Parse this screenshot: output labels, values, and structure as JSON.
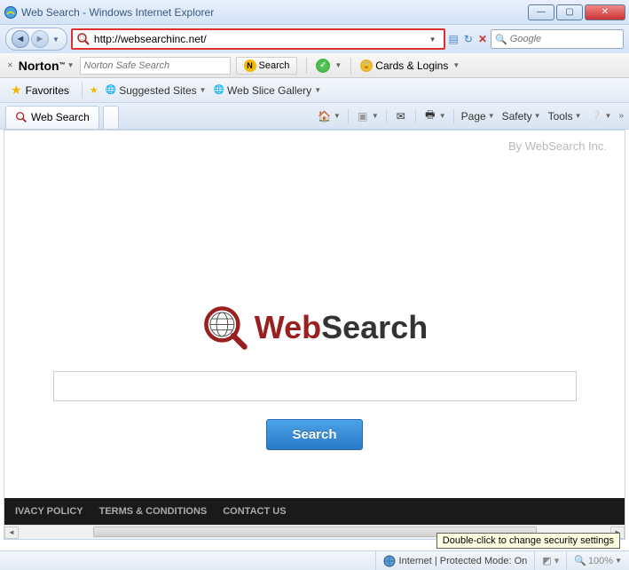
{
  "window": {
    "title": "Web Search - Windows Internet Explorer"
  },
  "address_bar": {
    "url": "http://websearchinc.net/"
  },
  "browser_search": {
    "placeholder": "Google"
  },
  "norton": {
    "brand": "Norton",
    "search_placeholder": "Norton Safe Search",
    "search_button": "Search",
    "cards_logins": "Cards & Logins"
  },
  "favorites_bar": {
    "favorites": "Favorites",
    "suggested_sites": "Suggested Sites",
    "web_slice_gallery": "Web Slice Gallery"
  },
  "tab": {
    "title": "Web Search"
  },
  "command_bar": {
    "page": "Page",
    "safety": "Safety",
    "tools": "Tools"
  },
  "page": {
    "attribution": "By WebSearch Inc.",
    "logo_web": "Web",
    "logo_search": "Search",
    "search_button": "Search",
    "footer_privacy": "IVACY POLICY",
    "footer_terms": "TERMS & CONDITIONS",
    "footer_contact": "CONTACT US"
  },
  "status_bar": {
    "zone": "Internet | Protected Mode: On",
    "zoom": "100%",
    "tooltip": "Double-click to change security settings"
  }
}
